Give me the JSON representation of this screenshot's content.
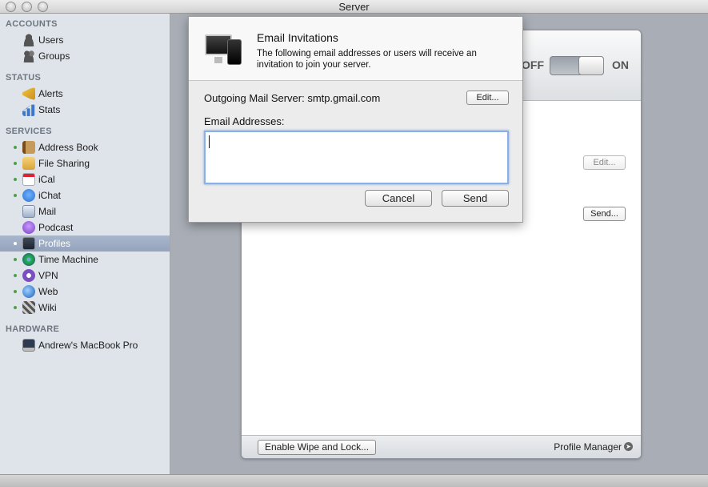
{
  "window": {
    "title": "Server"
  },
  "sidebar": {
    "sections": {
      "accounts": "ACCOUNTS",
      "status": "STATUS",
      "services": "SERVICES",
      "hardware": "HARDWARE"
    },
    "accounts": [
      {
        "label": "Users",
        "icon": "user-icon"
      },
      {
        "label": "Groups",
        "icon": "group-icon"
      }
    ],
    "status": [
      {
        "label": "Alerts",
        "icon": "alert-icon"
      },
      {
        "label": "Stats",
        "icon": "stats-icon"
      }
    ],
    "services": [
      {
        "label": "Address Book",
        "icon": "address-book-icon"
      },
      {
        "label": "File Sharing",
        "icon": "file-sharing-icon"
      },
      {
        "label": "iCal",
        "icon": "ical-icon"
      },
      {
        "label": "iChat",
        "icon": "ichat-icon"
      },
      {
        "label": "Mail",
        "icon": "mail-icon"
      },
      {
        "label": "Podcast",
        "icon": "podcast-icon"
      },
      {
        "label": "Profiles",
        "icon": "profiles-icon",
        "selected": true
      },
      {
        "label": "Time Machine",
        "icon": "time-machine-icon"
      },
      {
        "label": "VPN",
        "icon": "vpn-icon"
      },
      {
        "label": "Web",
        "icon": "web-icon"
      },
      {
        "label": "Wiki",
        "icon": "wiki-icon"
      }
    ],
    "hardware": [
      {
        "label": "Andrew's MacBook Pro",
        "icon": "macbook-icon"
      }
    ]
  },
  "panel": {
    "toggle_off": "OFF",
    "toggle_on": "ON",
    "toggle_state": "on",
    "edit_label": "Edit...",
    "send_label": "Send...",
    "footer_button": "Enable Wipe and Lock...",
    "footer_link": "Profile Manager"
  },
  "dialog": {
    "title": "Email Invitations",
    "description": "The following email addresses or users will receive an invitation to join your server.",
    "mail_server_label": "Outgoing Mail Server: smtp.gmail.com",
    "edit_label": "Edit...",
    "addresses_label": "Email Addresses:",
    "addresses_value": "",
    "cancel_label": "Cancel",
    "send_label": "Send"
  },
  "colors": {
    "sidebar_bg": "#dfe4ea",
    "selection": "#a9b6cc",
    "service_dot": "#4aa246",
    "focus_ring": "#8ab0e6"
  }
}
